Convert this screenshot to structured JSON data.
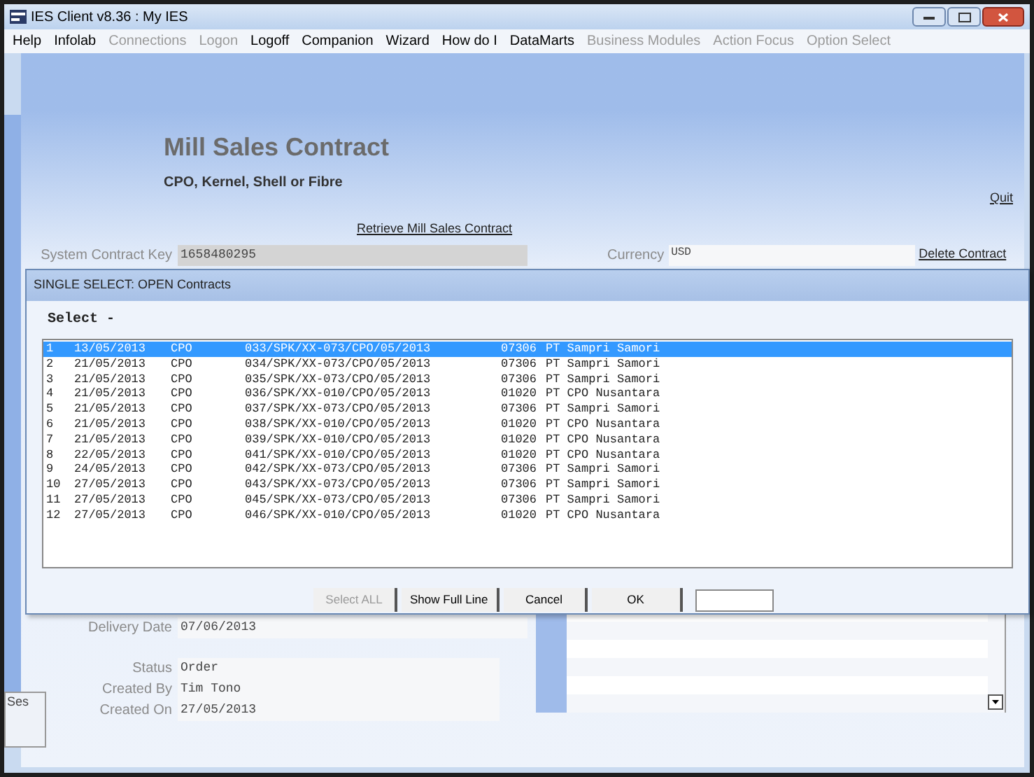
{
  "window": {
    "title": "IES Client v8.36 : My IES"
  },
  "menu": [
    {
      "label": "Help",
      "disabled": false
    },
    {
      "label": "Infolab",
      "disabled": false
    },
    {
      "label": "Connections",
      "disabled": true
    },
    {
      "label": "Logon",
      "disabled": true
    },
    {
      "label": "Logoff",
      "disabled": false
    },
    {
      "label": "Companion",
      "disabled": false
    },
    {
      "label": "Wizard",
      "disabled": false
    },
    {
      "label": "How do I",
      "disabled": false
    },
    {
      "label": "DataMarts",
      "disabled": false
    },
    {
      "label": "Business Modules",
      "disabled": true
    },
    {
      "label": "Action Focus",
      "disabled": true
    },
    {
      "label": "Option Select",
      "disabled": true
    }
  ],
  "form": {
    "title": "Mill Sales Contract",
    "subtitle": "CPO, Kernel, Shell or Fibre",
    "quit": "Quit",
    "retrieve": "Retrieve Mill Sales Contract",
    "delete": "Delete Contract",
    "contract_key": {
      "label": "System Contract Key",
      "value": "1658480295"
    },
    "currency": {
      "label": "Currency",
      "value": "USD"
    },
    "delivery_date": {
      "label": "Delivery Date",
      "value": "07/06/2013"
    },
    "status": {
      "label": "Status",
      "value": "Order"
    },
    "created_by": {
      "label": "Created By",
      "value": "Tim Tono"
    },
    "created_on": {
      "label": "Created On",
      "value": "27/05/2013"
    },
    "side_tab": "Ses"
  },
  "dialog": {
    "title": "SINGLE SELECT: OPEN Contracts",
    "prompt": "Select -",
    "rows": [
      {
        "no": "1",
        "date": "13/05/2013",
        "type": "CPO",
        "contract": "033/SPK/XX-073/CPO/05/2013",
        "code": "07306",
        "party": "PT Sampri Samori",
        "selected": true
      },
      {
        "no": "2",
        "date": "21/05/2013",
        "type": "CPO",
        "contract": "034/SPK/XX-073/CPO/05/2013",
        "code": "07306",
        "party": "PT Sampri Samori",
        "selected": false
      },
      {
        "no": "3",
        "date": "21/05/2013",
        "type": "CPO",
        "contract": "035/SPK/XX-073/CPO/05/2013",
        "code": "07306",
        "party": "PT Sampri Samori",
        "selected": false
      },
      {
        "no": "4",
        "date": "21/05/2013",
        "type": "CPO",
        "contract": "036/SPK/XX-010/CPO/05/2013",
        "code": "01020",
        "party": "PT CPO Nusantara",
        "selected": false
      },
      {
        "no": "5",
        "date": "21/05/2013",
        "type": "CPO",
        "contract": "037/SPK/XX-073/CPO/05/2013",
        "code": "07306",
        "party": "PT Sampri Samori",
        "selected": false
      },
      {
        "no": "6",
        "date": "21/05/2013",
        "type": "CPO",
        "contract": "038/SPK/XX-010/CPO/05/2013",
        "code": "01020",
        "party": "PT CPO Nusantara",
        "selected": false
      },
      {
        "no": "7",
        "date": "21/05/2013",
        "type": "CPO",
        "contract": "039/SPK/XX-010/CPO/05/2013",
        "code": "01020",
        "party": "PT CPO Nusantara",
        "selected": false
      },
      {
        "no": "8",
        "date": "22/05/2013",
        "type": "CPO",
        "contract": "041/SPK/XX-010/CPO/05/2013",
        "code": "01020",
        "party": "PT CPO Nusantara",
        "selected": false
      },
      {
        "no": "9",
        "date": "24/05/2013",
        "type": "CPO",
        "contract": "042/SPK/XX-073/CPO/05/2013",
        "code": "07306",
        "party": "PT Sampri Samori",
        "selected": false
      },
      {
        "no": "10",
        "date": "27/05/2013",
        "type": "CPO",
        "contract": "043/SPK/XX-073/CPO/05/2013",
        "code": "07306",
        "party": "PT Sampri Samori",
        "selected": false
      },
      {
        "no": "11",
        "date": "27/05/2013",
        "type": "CPO",
        "contract": "045/SPK/XX-073/CPO/05/2013",
        "code": "07306",
        "party": "PT Sampri Samori",
        "selected": false
      },
      {
        "no": "12",
        "date": "27/05/2013",
        "type": "CPO",
        "contract": "046/SPK/XX-010/CPO/05/2013",
        "code": "01020",
        "party": "PT CPO Nusantara",
        "selected": false
      }
    ],
    "buttons": [
      {
        "label": "Select ALL",
        "disabled": true
      },
      {
        "label": "Show Full Line",
        "disabled": false
      },
      {
        "label": "Cancel",
        "disabled": false
      },
      {
        "label": "OK",
        "disabled": false
      }
    ]
  }
}
